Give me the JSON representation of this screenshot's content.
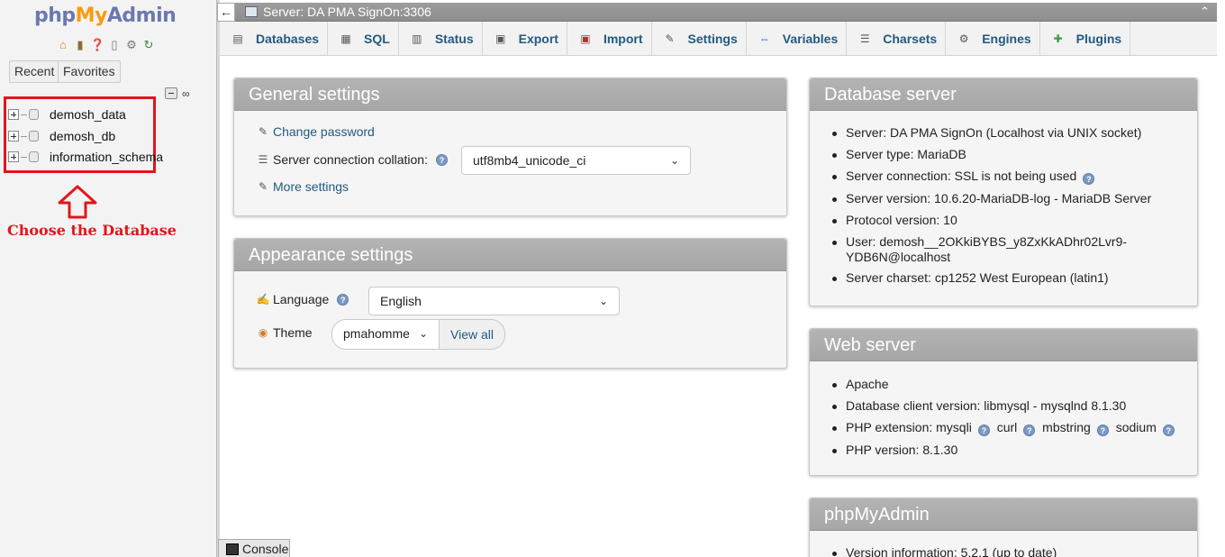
{
  "nav": {
    "logo": {
      "php": "php",
      "my": "My",
      "admin": "Admin"
    },
    "icons": [
      "home-icon",
      "database-exit-icon",
      "help-icon",
      "docs-icon",
      "settings-icon",
      "reload-icon"
    ],
    "recent_label": "Recent",
    "favorites_label": "Favorites",
    "databases": [
      "demosh_data",
      "demosh_db",
      "information_schema"
    ],
    "annotation": "Choose the Database",
    "annotation_color": "#e3141b"
  },
  "serverbar": {
    "title": "Server: DA PMA SignOn:3306"
  },
  "menu": {
    "tabs": [
      {
        "label": "Databases",
        "icon": "database-icon"
      },
      {
        "label": "SQL",
        "icon": "sql-icon"
      },
      {
        "label": "Status",
        "icon": "status-icon"
      },
      {
        "label": "Export",
        "icon": "export-icon"
      },
      {
        "label": "Import",
        "icon": "import-icon"
      },
      {
        "label": "Settings",
        "icon": "wrench-icon"
      },
      {
        "label": "Variables",
        "icon": "variables-icon"
      },
      {
        "label": "Charsets",
        "icon": "charsets-icon"
      },
      {
        "label": "Engines",
        "icon": "engines-icon"
      },
      {
        "label": "Plugins",
        "icon": "plugin-icon"
      }
    ]
  },
  "general": {
    "title": "General settings",
    "change_password": "Change password",
    "collation_label": "Server connection collation:",
    "collation_value": "utf8mb4_unicode_ci",
    "more_settings": "More settings"
  },
  "appearance": {
    "title": "Appearance settings",
    "language_label": "Language",
    "language_value": "English",
    "theme_label": "Theme",
    "theme_value": "pmahomme",
    "view_all": "View all"
  },
  "db_server": {
    "title": "Database server",
    "items": [
      "Server: DA PMA SignOn (Localhost via UNIX socket)",
      "Server type: MariaDB",
      "Server connection: SSL is not being used",
      "Server version: 10.6.20-MariaDB-log - MariaDB Server",
      "Protocol version: 10",
      "User: demosh__2OKkiBYBS_y8ZxKkADhr02Lvr9-",
      "YDB6N@localhost",
      "Server charset: cp1252 West European (latin1)"
    ]
  },
  "web_server": {
    "title": "Web server",
    "items": [
      "Apache",
      "Database client version: libmysql - mysqlnd 8.1.30",
      "PHP extension: mysqli",
      "PHP version: 8.1.30"
    ],
    "php_extensions_extra": [
      "curl",
      "mbstring",
      "sodium"
    ]
  },
  "pma": {
    "title": "phpMyAdmin",
    "version": "Version information: 5.2.1 (up to date)"
  },
  "console_label": "Console"
}
